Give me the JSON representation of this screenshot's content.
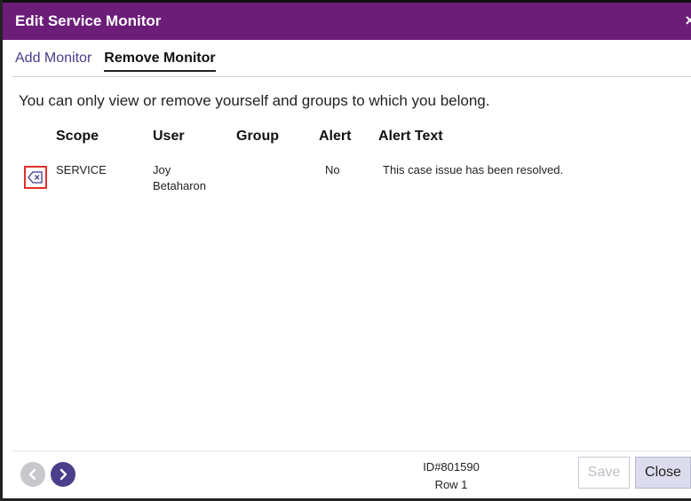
{
  "window": {
    "title": "Edit Service Monitor",
    "close_glyph": "×"
  },
  "tabs": [
    {
      "label": "Add Monitor",
      "active": false
    },
    {
      "label": "Remove Monitor",
      "active": true
    }
  ],
  "notice": "You can only view or remove yourself and groups to which you belong.",
  "table": {
    "headers": [
      "Scope",
      "User",
      "Group",
      "Alert",
      "Alert Text"
    ],
    "rows": [
      {
        "scope": "SERVICE",
        "user_line1": "Joy",
        "user_line2": "Betaharon",
        "group": "",
        "alert": "No",
        "alert_text": "This case issue has been resolved."
      }
    ]
  },
  "footer": {
    "id_label": "ID#801590",
    "row_label": "Row 1",
    "save_label": "Save",
    "close_label": "Close"
  },
  "icons": {
    "remove": "backspace-x-icon",
    "prev": "chevron-left-icon",
    "next": "chevron-right-icon",
    "close": "close-icon"
  },
  "colors": {
    "titlebar": "#6b1d78",
    "remove_highlight": "#e2302c",
    "nav_next": "#4b3f8c",
    "nav_prev": "#c7c7cc"
  }
}
